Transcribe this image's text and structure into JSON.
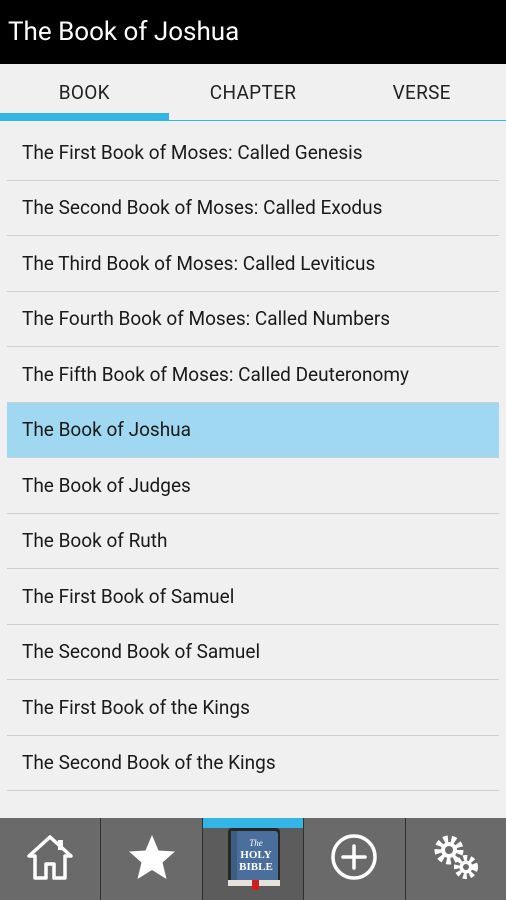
{
  "app": {
    "title": "The Book of Joshua"
  },
  "tabs": [
    {
      "label": "BOOK"
    },
    {
      "label": "CHAPTER"
    },
    {
      "label": "VERSE"
    }
  ],
  "books": [
    "The First Book of Moses: Called Genesis",
    "The Second Book of Moses: Called Exodus",
    "The Third Book of Moses: Called Leviticus",
    "The Fourth Book of Moses: Called Numbers",
    "The Fifth Book of Moses: Called Deuteronomy",
    "The Book of Joshua",
    "The Book of Judges",
    "The Book of Ruth",
    "The First Book of Samuel",
    "The Second Book of Samuel",
    "The First Book of the Kings",
    "The Second Book of the Kings"
  ],
  "bottom_nav": {
    "icons": [
      "home-icon",
      "star-icon",
      "holy-bible-icon",
      "add-circle-icon",
      "gears-icon"
    ],
    "bible_logo": {
      "line1": "The",
      "line2": "HOLY",
      "line3": "BIBLE"
    }
  },
  "colors": {
    "accent": "#33b5e5",
    "selected_row": "#9fd8f0",
    "titlebar": "#000000"
  }
}
